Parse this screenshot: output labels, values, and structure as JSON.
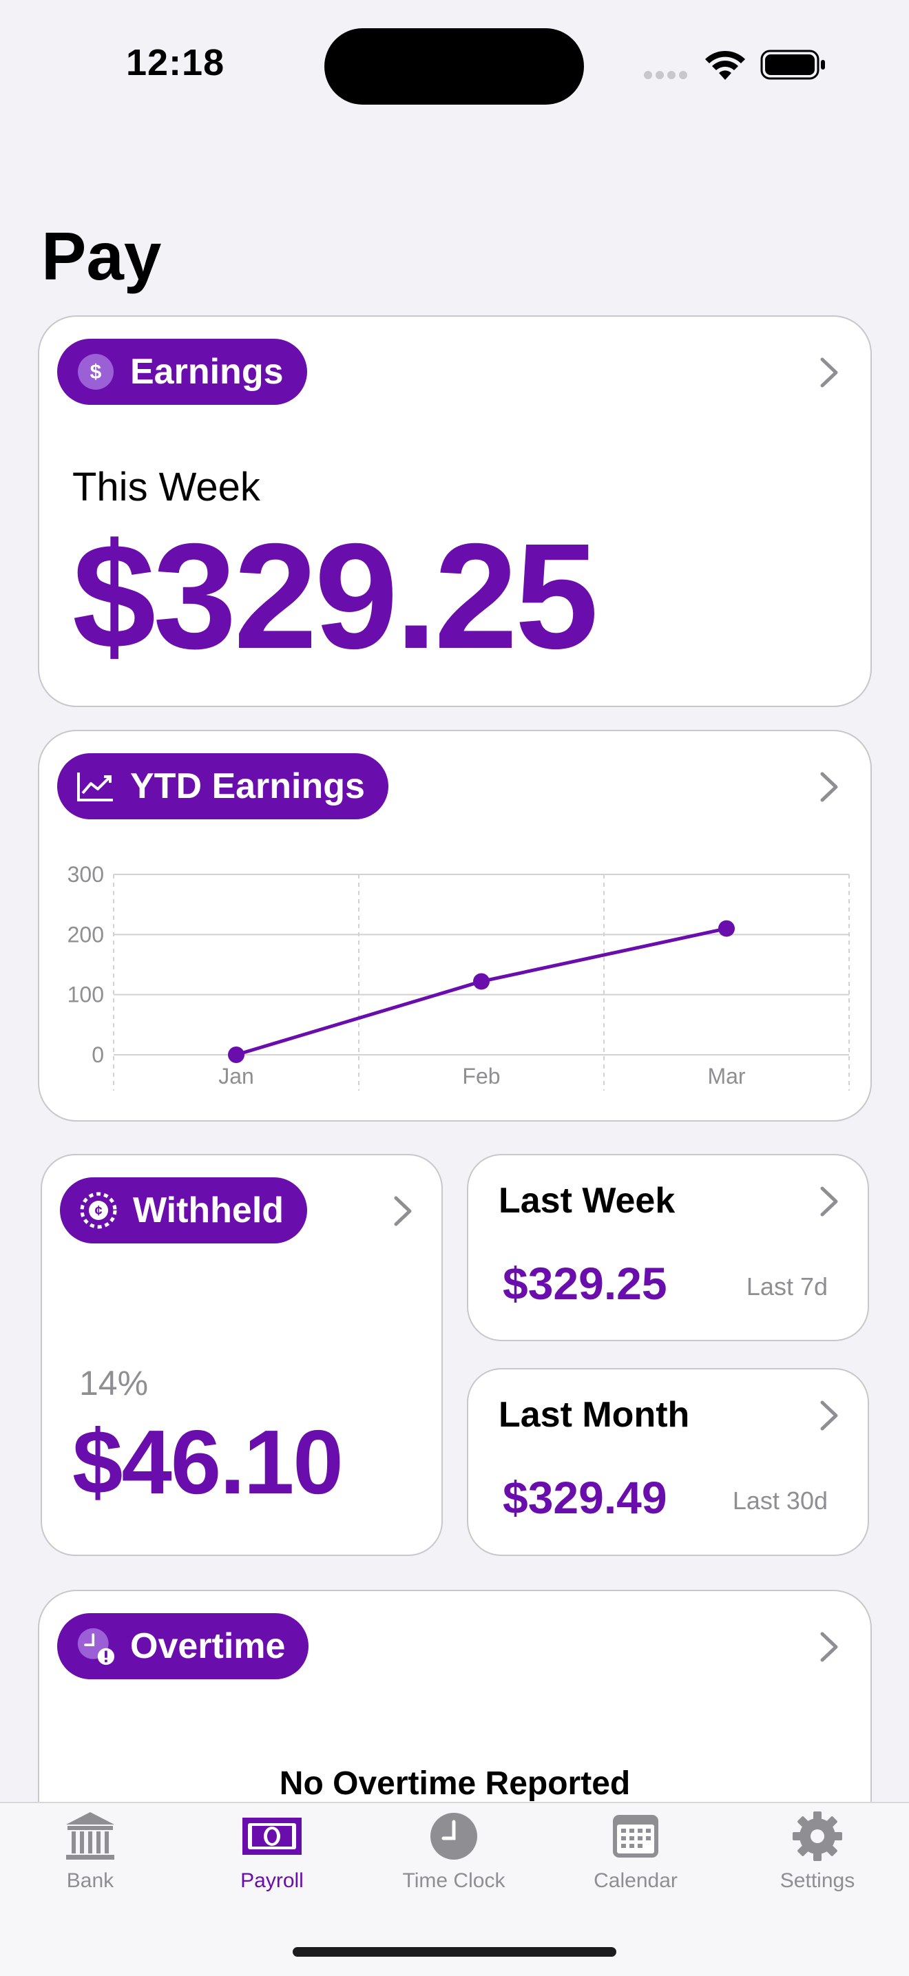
{
  "status": {
    "time": "12:18"
  },
  "page": {
    "title": "Pay"
  },
  "earnings": {
    "label": "Earnings",
    "period": "This Week",
    "amount": "$329.25"
  },
  "ytd": {
    "label": "YTD Earnings",
    "chart_data": {
      "type": "line",
      "categories": [
        "Jan",
        "Feb",
        "Mar"
      ],
      "series": [
        {
          "values": [
            0,
            122,
            210
          ]
        }
      ],
      "yticks": [
        0,
        100,
        200,
        300
      ],
      "ylim": [
        0,
        300
      ],
      "grid": true,
      "color": "#6a0dad"
    }
  },
  "withheld": {
    "label": "Withheld",
    "percent": "14%",
    "amount": "$46.10"
  },
  "last_week": {
    "title": "Last Week",
    "amount": "$329.25",
    "range": "Last 7d"
  },
  "last_month": {
    "title": "Last Month",
    "amount": "$329.49",
    "range": "Last 30d"
  },
  "overtime": {
    "label": "Overtime",
    "message": "No Overtime Reported"
  },
  "tabs": [
    {
      "label": "Bank",
      "icon": "bank-icon"
    },
    {
      "label": "Payroll",
      "icon": "payroll-icon",
      "active": true
    },
    {
      "label": "Time Clock",
      "icon": "clock-icon"
    },
    {
      "label": "Calendar",
      "icon": "calendar-icon"
    },
    {
      "label": "Settings",
      "icon": "gear-icon"
    }
  ],
  "colors": {
    "accent": "#6a0dad",
    "background": "#f2f2f7"
  }
}
